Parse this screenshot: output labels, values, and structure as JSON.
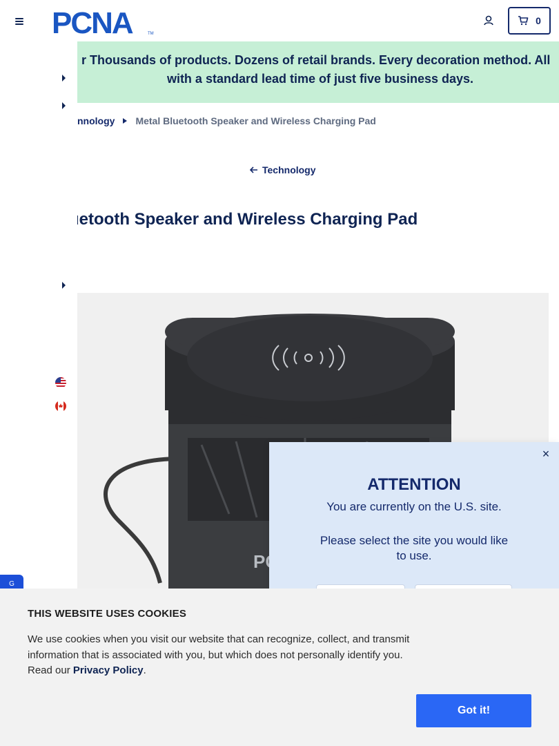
{
  "header": {
    "logo_text": "PCNA",
    "cart_count": "0"
  },
  "banner": {
    "line1": "r Thousands of products. Dozens of retail brands. Every decoration method. All",
    "line2": "with a standard lead time of just five business days."
  },
  "breadcrumb": {
    "parent": "nnology",
    "current": "Metal Bluetooth Speaker and Wireless Charging Pad"
  },
  "back_link": "Technology",
  "product": {
    "title": "uetooth Speaker and Wireless Charging Pad"
  },
  "feedback_tab": "G",
  "attention": {
    "close": "×",
    "title": "ATTENTION",
    "message": "You are currently on the U.S. site.",
    "prompt": "Please select the site you would like to use."
  },
  "cookies": {
    "title": "THIS WEBSITE USES COOKIES",
    "text": "We use cookies when you visit our website that can recognize, collect, and transmit information that is associated with you, but which does not personally identify you. Read our ",
    "link": "Privacy Policy",
    "end": ".",
    "button": "Got it!"
  }
}
